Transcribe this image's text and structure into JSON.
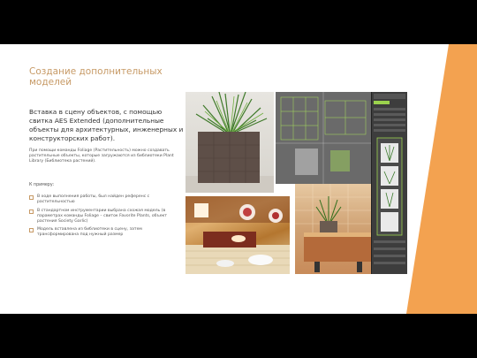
{
  "slide": {
    "title": "Создание дополнительных моделей",
    "subtitle": "Вставка в сцену объектов, с помощью свитка AES Extended (дополнительные объекты для архитектурных, инженерных и конструкторских работ).",
    "body": "При помощи команды Foliage (Растительность) можно создавать растительные объекты, которые загружаются из библиотеки Plant Library (Библиотека растений).",
    "example_label": "К примеру:",
    "bullets": [
      "В ходе выполнения работы, был найден референс с растительностью",
      "В стандартном инструментарии выбрана схожая модель (в параметрах команды Foliage – свиток Favorite Plants, объект растения Society Garlic)",
      "Модель вставлена из библиотеки в сцену, затем трансформирована под нужный размер"
    ]
  },
  "colors": {
    "accent": "#f3a250",
    "title": "#c79a66",
    "background": "#ffffff",
    "letterbox": "#000000"
  },
  "images": {
    "plant": "plant-in-pot-render",
    "kitchen": "kitchen-interior-render",
    "viewport": "3d-viewport-wireframe",
    "render": "interior-render-with-plants",
    "panel": "command-panel-foliage"
  }
}
